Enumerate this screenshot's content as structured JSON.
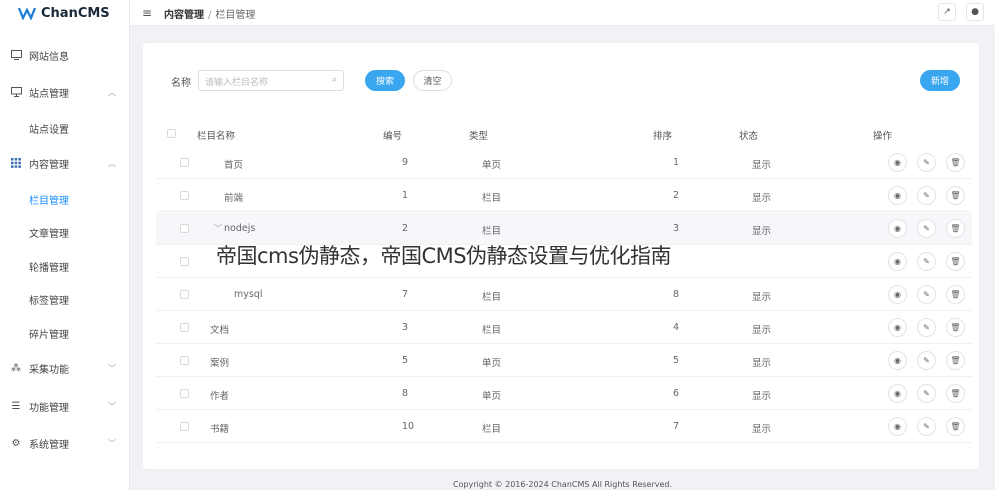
{
  "app": {
    "logo_text": "ChanCMS"
  },
  "sidebar": {
    "items": [
      {
        "label": "网站信息",
        "icon": "site-info-icon"
      },
      {
        "label": "站点管理",
        "icon": "monitor-icon",
        "chevron": "^"
      },
      {
        "label": "站点设置"
      },
      {
        "label": "内容管理",
        "icon": "grid-icon",
        "chevron": "^"
      },
      {
        "label": "栏目管理",
        "active": true
      },
      {
        "label": "文章管理"
      },
      {
        "label": "轮播管理"
      },
      {
        "label": "标签管理"
      },
      {
        "label": "碎片管理"
      },
      {
        "label": "采集功能",
        "icon": "collect-icon",
        "chevron": "v"
      },
      {
        "label": "功能管理",
        "icon": "sliders-icon",
        "chevron": "v"
      },
      {
        "label": "系统管理",
        "icon": "gear-icon",
        "chevron": "v"
      }
    ]
  },
  "header": {
    "breadcrumb_1": "内容管理",
    "breadcrumb_sep": "/",
    "breadcrumb_2": "栏目管理"
  },
  "search": {
    "label": "名称",
    "placeholder": "请输入栏目名称",
    "search_btn": "搜索",
    "clear_btn": "清空",
    "add_btn": "新增"
  },
  "table": {
    "headers": {
      "name": "栏目名称",
      "id": "编号",
      "type": "类型",
      "sort": "排序",
      "status": "状态",
      "ops": "操作"
    },
    "rows": [
      {
        "name": "首页",
        "id": "9",
        "type": "单页",
        "sort": "1",
        "status": "显示"
      },
      {
        "name": "前端",
        "id": "1",
        "type": "栏目",
        "sort": "2",
        "status": "显示"
      },
      {
        "name": "nodejs",
        "id": "2",
        "type": "栏目",
        "sort": "3",
        "status": "显示"
      },
      {
        "name": "",
        "id": "",
        "type": "",
        "sort": "",
        "status": ""
      },
      {
        "name": "mysql",
        "id": "7",
        "type": "栏目",
        "sort": "8",
        "status": "显示"
      },
      {
        "name": "文档",
        "id": "3",
        "type": "栏目",
        "sort": "4",
        "status": "显示"
      },
      {
        "name": "案例",
        "id": "5",
        "type": "单页",
        "sort": "5",
        "status": "显示"
      },
      {
        "name": "作者",
        "id": "8",
        "type": "单页",
        "sort": "6",
        "status": "显示"
      },
      {
        "name": "书籍",
        "id": "10",
        "type": "栏目",
        "sort": "7",
        "status": "显示"
      }
    ]
  },
  "footer": {
    "copyright": "Copyright © 2016-2024 ChanCMS All Rights Reserved."
  },
  "overlay": {
    "text": "帝国cms伪静态，帝国CMS伪静态设置与优化指南"
  },
  "colors": {
    "accent": "#3aa6f0",
    "active_nav": "#1890ff"
  }
}
